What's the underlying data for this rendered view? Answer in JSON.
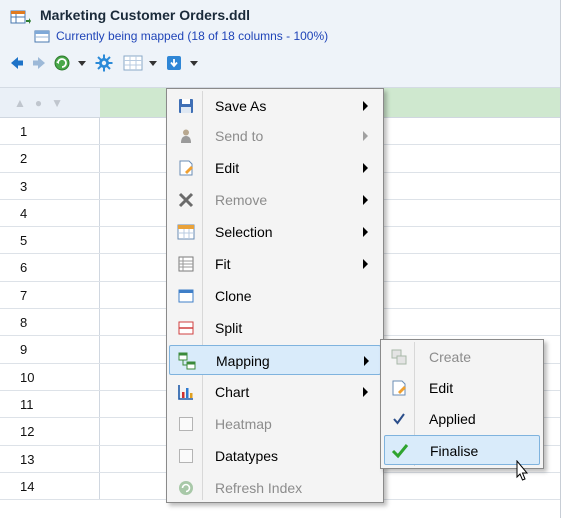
{
  "header": {
    "title": "Marketing Customer Orders.ddl",
    "subtitle": "Currently being mapped (18 of 18 columns - 100%)"
  },
  "toolbar": {
    "icons": [
      "back-arrow-icon",
      "forward-arrow-icon",
      "refresh-globe-icon",
      "settings-gear-icon",
      "grid-view-icon",
      "export-icon"
    ]
  },
  "grid": {
    "row_numbers": [
      "1",
      "2",
      "3",
      "4",
      "5",
      "6",
      "7",
      "8",
      "9",
      "10",
      "11",
      "12",
      "13",
      "14"
    ]
  },
  "context_menu": {
    "items": [
      {
        "label": "Save As",
        "icon": "save-icon",
        "has_submenu": true,
        "enabled": true
      },
      {
        "label": "Send to",
        "icon": "person-icon",
        "has_submenu": true,
        "enabled": false
      },
      {
        "label": "Edit",
        "icon": "edit-icon",
        "has_submenu": true,
        "enabled": true
      },
      {
        "label": "Remove",
        "icon": "remove-x-icon",
        "has_submenu": true,
        "enabled": false
      },
      {
        "label": "Selection",
        "icon": "selection-icon",
        "has_submenu": true,
        "enabled": true
      },
      {
        "label": "Fit",
        "icon": "fit-icon",
        "has_submenu": true,
        "enabled": true
      },
      {
        "label": "Clone",
        "icon": "clone-icon",
        "has_submenu": false,
        "enabled": true
      },
      {
        "label": "Split",
        "icon": "split-icon",
        "has_submenu": false,
        "enabled": true
      },
      {
        "label": "Mapping",
        "icon": "mapping-icon",
        "has_submenu": true,
        "enabled": true,
        "highlighted": true
      },
      {
        "label": "Chart",
        "icon": "chart-icon",
        "has_submenu": true,
        "enabled": true
      },
      {
        "label": "Heatmap",
        "icon": "checkbox-icon",
        "has_submenu": false,
        "enabled": false
      },
      {
        "label": "Datatypes",
        "icon": "checkbox-icon",
        "has_submenu": false,
        "enabled": true
      },
      {
        "label": "Refresh Index",
        "icon": "refresh-icon",
        "has_submenu": false,
        "enabled": false
      }
    ]
  },
  "mapping_submenu": {
    "items": [
      {
        "label": "Create",
        "icon": "create-icon",
        "enabled": false
      },
      {
        "label": "Edit",
        "icon": "edit-icon",
        "enabled": true
      },
      {
        "label": "Applied",
        "icon": "checkmark-icon",
        "enabled": true,
        "checked": true
      },
      {
        "label": "Finalise",
        "icon": "green-check-icon",
        "enabled": true,
        "highlighted": true
      }
    ]
  },
  "colors": {
    "header_bg": "#eef3f9",
    "title_text": "#1a2a3a",
    "subtitle_text": "#1f44b8",
    "highlight_bg": "#d9ebfa",
    "highlight_border": "#7fb3de",
    "selected_column": "#cfe8cf"
  }
}
